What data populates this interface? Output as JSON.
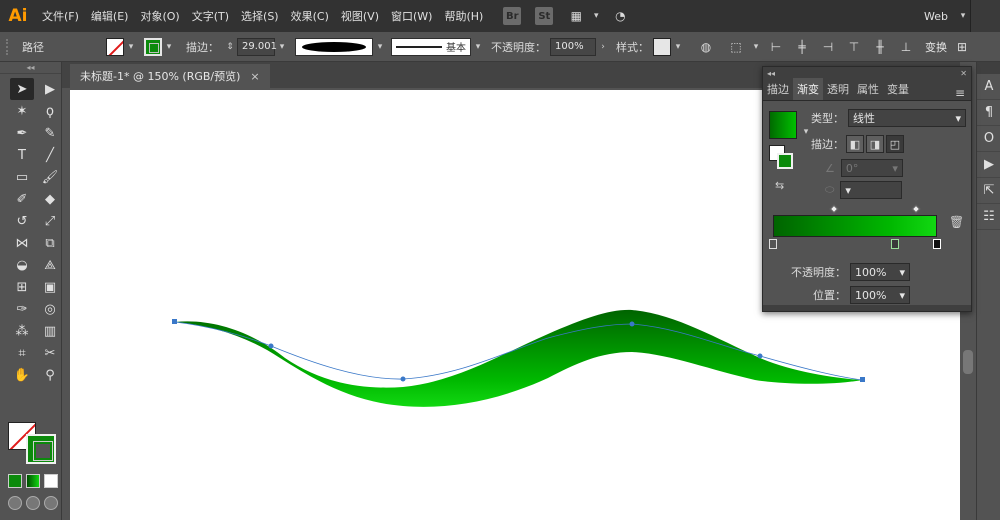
{
  "app": {
    "logo": "Ai",
    "workspace": "Web",
    "menu": [
      "文件(F)",
      "编辑(E)",
      "对象(O)",
      "文字(T)",
      "选择(S)",
      "效果(C)",
      "视图(V)",
      "窗口(W)",
      "帮助(H)"
    ],
    "menu_icons": [
      "Br",
      "St"
    ]
  },
  "control_bar": {
    "object_type": "路径",
    "stroke_label": "描边：",
    "stroke_weight": "29.001",
    "stroke_profile": "基本",
    "opacity_label": "不透明度：",
    "opacity_value": "100%",
    "style_label": "样式：",
    "transform_label": "变换"
  },
  "document": {
    "tab_title": "未标题-1* @ 150% (RGB/预览)",
    "close_symbol": "×"
  },
  "gradient_panel": {
    "tabs": [
      "描边",
      "渐变",
      "透明",
      "属性",
      "变量"
    ],
    "active_tab": "渐变",
    "type_label": "类型：",
    "type_value": "线性",
    "stroke_label": "描边：",
    "angle_value": "0°",
    "opacity_label": "不透明度：",
    "opacity_value": "100%",
    "position_label": "位置：",
    "position_value": "100%"
  },
  "colors": {
    "gradient_start": "#006400",
    "gradient_end": "#12d812",
    "path_stroke": "#3a78c8",
    "ui_bg": "#535353"
  },
  "icons": {
    "tools": [
      "selection-icon",
      "direct-selection-icon",
      "magic-wand-icon",
      "lasso-icon",
      "pen-icon",
      "curvature-icon",
      "type-icon",
      "line-icon",
      "rectangle-icon",
      "paintbrush-icon",
      "shaper-icon",
      "eraser-icon",
      "rotate-icon",
      "scale-icon",
      "width-icon",
      "free-transform-icon",
      "shape-builder-icon",
      "perspective-icon",
      "mesh-icon",
      "gradient-icon",
      "eyedropper-icon",
      "blend-icon",
      "symbol-sprayer-icon",
      "column-graph-icon",
      "artboard-icon",
      "slice-icon",
      "hand-icon",
      "zoom-icon"
    ],
    "right_tools": [
      "character-icon",
      "paragraph-icon",
      "opentype-icon",
      "play-icon",
      "export-icon",
      "layers-icon"
    ]
  }
}
